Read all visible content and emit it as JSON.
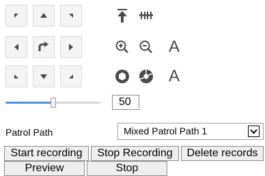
{
  "ptz": {
    "directions": [
      "up-left",
      "up",
      "up-right",
      "left",
      "auto-rotate",
      "right",
      "down-left",
      "down",
      "down-right"
    ],
    "zoom_in_label": "A",
    "zoom_out_label": "A"
  },
  "speed": {
    "value": "50",
    "level_percent": 50
  },
  "patrol": {
    "label": "Patrol Path",
    "selected": "Mixed Patrol Path 1"
  },
  "actions": {
    "start_recording": "Start recording",
    "stop_recording": "Stop Recording",
    "delete_records": "Delete records",
    "preview": "Preview",
    "stop": "Stop"
  }
}
